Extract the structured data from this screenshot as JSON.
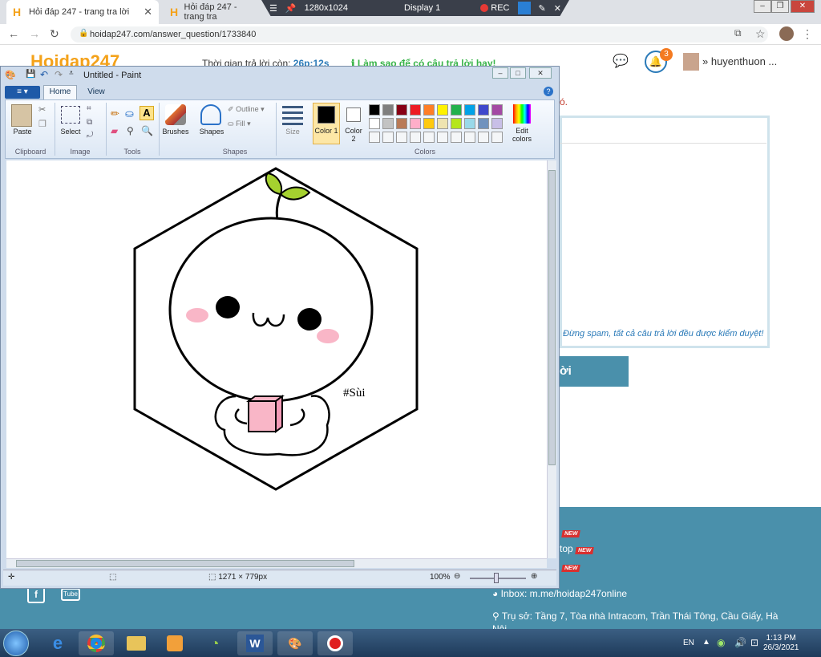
{
  "browser": {
    "tabs": [
      {
        "title": "Hỏi đáp 247 - trang tra lời"
      },
      {
        "title": "Hỏi đáp 247 - trang tra"
      }
    ],
    "url": "hoidap247.com/answer_question/1733840"
  },
  "recorder": {
    "resolution": "1280x1024",
    "display": "Display 1",
    "rec_label": "REC"
  },
  "site": {
    "logo_main": "Hoidap",
    "logo_num": "247",
    "timer_label": "Thời gian trả lời còn:",
    "timer_value": "26p:12s",
    "hint": "Làm sao để có câu trả lời hay!",
    "notif_count": "3",
    "username": "huyenthuon ...",
    "note": "ó.",
    "spam_note": "Đừng spam, tất cả câu trả lời đều được kiểm duyệt!",
    "submit_label": "ời",
    "footer": {
      "new_tag": "NEW",
      "line2": "top",
      "inbox": "Inbox: m.me/hoidap247online",
      "address": "Trụ sở: Tầng 7, Tòa nhà Intracom, Trần Thái Tông, Cầu Giấy, Hà",
      "address2": "Nội"
    }
  },
  "paint": {
    "title": "Untitled - Paint",
    "file_btn": "≡ ▾",
    "tabs": [
      "Home",
      "View"
    ],
    "ribbon": {
      "paste": "Paste",
      "select": "Select",
      "brushes": "Brushes",
      "shapes": "Shapes",
      "outline": "Outline",
      "fill": "Fill",
      "size": "Size",
      "color1": "Color 1",
      "color2": "Color 2",
      "edit_colors": "Edit colors",
      "groups": [
        "Clipboard",
        "Image",
        "Tools",
        "Shapes",
        "Colors"
      ]
    },
    "palette_row1": [
      "#000000",
      "#7f7f7f",
      "#880015",
      "#ed1c24",
      "#ff7f27",
      "#fff200",
      "#22b14c",
      "#00a2e8",
      "#3f48cc",
      "#a349a4"
    ],
    "palette_row2": [
      "#ffffff",
      "#c3c3c3",
      "#b97a57",
      "#ffaec9",
      "#ffc90e",
      "#efe4b0",
      "#b5e61d",
      "#99d9ea",
      "#7092be",
      "#c8bfe7"
    ],
    "canvas_text": "#Sùi",
    "status": {
      "size": "1271 × 779px",
      "zoom": "100%"
    }
  },
  "taskbar": {
    "lang": "EN",
    "time": "1:13 PM",
    "date": "26/3/2021"
  }
}
